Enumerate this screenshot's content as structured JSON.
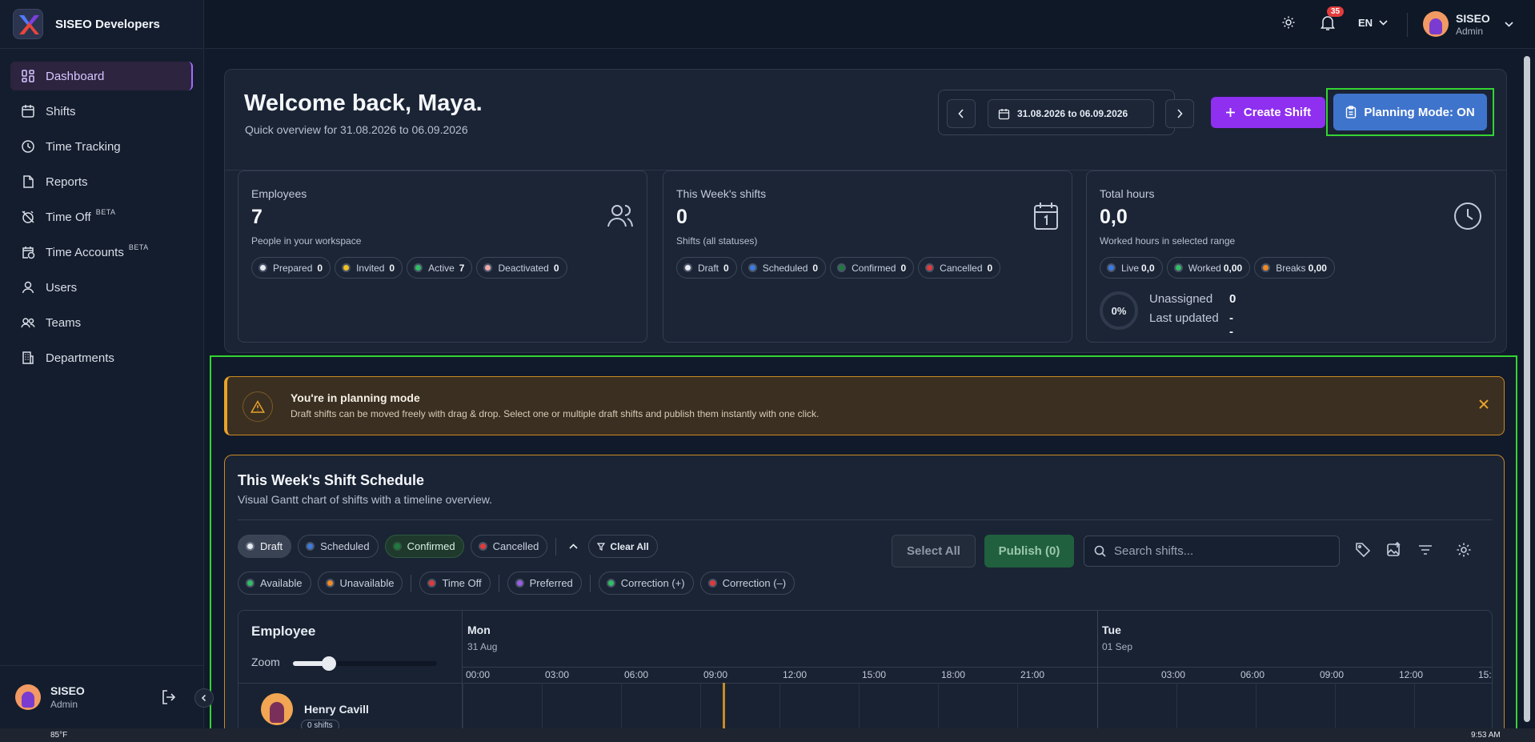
{
  "brand": {
    "name": "SISEO Developers"
  },
  "sidebar": {
    "items": [
      {
        "label": "Dashboard",
        "icon": "dashboard-icon",
        "badge": ""
      },
      {
        "label": "Shifts",
        "icon": "calendar-icon",
        "badge": ""
      },
      {
        "label": "Time Tracking",
        "icon": "clock-icon",
        "badge": ""
      },
      {
        "label": "Reports",
        "icon": "document-icon",
        "badge": ""
      },
      {
        "label": "Time Off",
        "icon": "alarm-off-icon",
        "badge": "BETA"
      },
      {
        "label": "Time Accounts",
        "icon": "calendar-clock-icon",
        "badge": "BETA"
      },
      {
        "label": "Users",
        "icon": "user-icon",
        "badge": ""
      },
      {
        "label": "Teams",
        "icon": "users-icon",
        "badge": ""
      },
      {
        "label": "Departments",
        "icon": "building-icon",
        "badge": ""
      }
    ],
    "user": {
      "name": "SISEO",
      "role": "Admin"
    }
  },
  "topbar": {
    "notifications_count": "35",
    "language": "EN",
    "user": {
      "name": "SISEO",
      "role": "Admin"
    }
  },
  "welcome": {
    "title": "Welcome back, Maya.",
    "subtitle": "Quick overview for 31.08.2026 to 06.09.2026",
    "date_range": "31.08.2026 to 06.09.2026",
    "create_shift": "Create Shift",
    "planning_mode": "Planning Mode: ON"
  },
  "stats": {
    "employees": {
      "label": "Employees",
      "value": "7",
      "desc": "People in your workspace",
      "pills": [
        {
          "label": "Prepared",
          "count": "0",
          "color": "#e8ebf0"
        },
        {
          "label": "Invited",
          "count": "0",
          "color": "#f2c21b"
        },
        {
          "label": "Active",
          "count": "7",
          "color": "#2fbf62"
        },
        {
          "label": "Deactivated",
          "count": "0",
          "color": "#f0a8a8"
        }
      ]
    },
    "shifts": {
      "label": "This Week's shifts",
      "value": "0",
      "desc": "Shifts (all statuses)",
      "pills": [
        {
          "label": "Draft",
          "count": "0",
          "color": "#e8ebf0"
        },
        {
          "label": "Scheduled",
          "count": "0",
          "color": "#3a7be0"
        },
        {
          "label": "Confirmed",
          "count": "0",
          "color": "#1f7a3e"
        },
        {
          "label": "Cancelled",
          "count": "0",
          "color": "#e03a3a"
        }
      ]
    },
    "hours": {
      "label": "Total hours",
      "value": "0,0",
      "desc": "Worked hours in selected range",
      "pills": [
        {
          "label": "Live",
          "count": "0,0",
          "color": "#3a7be0"
        },
        {
          "label": "Worked",
          "count": "0,00",
          "color": "#2fbf62"
        },
        {
          "label": "Breaks",
          "count": "0,00",
          "color": "#f08a24"
        }
      ],
      "ring": "0%",
      "unassigned_label": "Unassigned",
      "unassigned_value": "0",
      "updated_label": "Last updated",
      "updated_value": "--"
    }
  },
  "banner": {
    "title": "You're in planning mode",
    "text": "Draft shifts can be moved freely with drag & drop. Select one or multiple draft shifts and publish them instantly with one click."
  },
  "schedule": {
    "title": "This Week's Shift Schedule",
    "subtitle": "Visual Gantt chart of shifts with a timeline overview.",
    "status_filters": [
      {
        "label": "Draft",
        "color": "#e8ebf0"
      },
      {
        "label": "Scheduled",
        "color": "#3a7be0"
      },
      {
        "label": "Confirmed",
        "color": "#1f7a3e"
      },
      {
        "label": "Cancelled",
        "color": "#e03a3a"
      }
    ],
    "clear_all": "Clear All",
    "availability_filters": [
      {
        "label": "Available",
        "color": "#2fbf62"
      },
      {
        "label": "Unavailable",
        "color": "#f08a24"
      },
      {
        "label": "Time Off",
        "color": "#e03a3a"
      },
      {
        "label": "Preferred",
        "color": "#9b5de5"
      },
      {
        "label": "Correction (+)",
        "color": "#2fbf62"
      },
      {
        "label": "Correction (–)",
        "color": "#e03a3a"
      }
    ],
    "select_all": "Select All",
    "publish": "Publish (0)",
    "search_placeholder": "Search shifts...",
    "gantt": {
      "employee_header": "Employee",
      "zoom_label": "Zoom",
      "days": [
        {
          "name": "Mon",
          "date": "31 Aug"
        },
        {
          "name": "Tue",
          "date": "01 Sep"
        }
      ],
      "hours_mon": [
        "00:00",
        "03:00",
        "06:00",
        "09:00",
        "12:00",
        "15:00",
        "18:00",
        "21:00"
      ],
      "hours_tue": [
        "03:00",
        "06:00",
        "09:00",
        "12:00",
        "15:"
      ],
      "employees": [
        {
          "name": "Henry Cavill",
          "shifts": "0 shifts"
        }
      ]
    }
  },
  "taskbar": {
    "left": "85°F",
    "right": "9:53 AM"
  }
}
